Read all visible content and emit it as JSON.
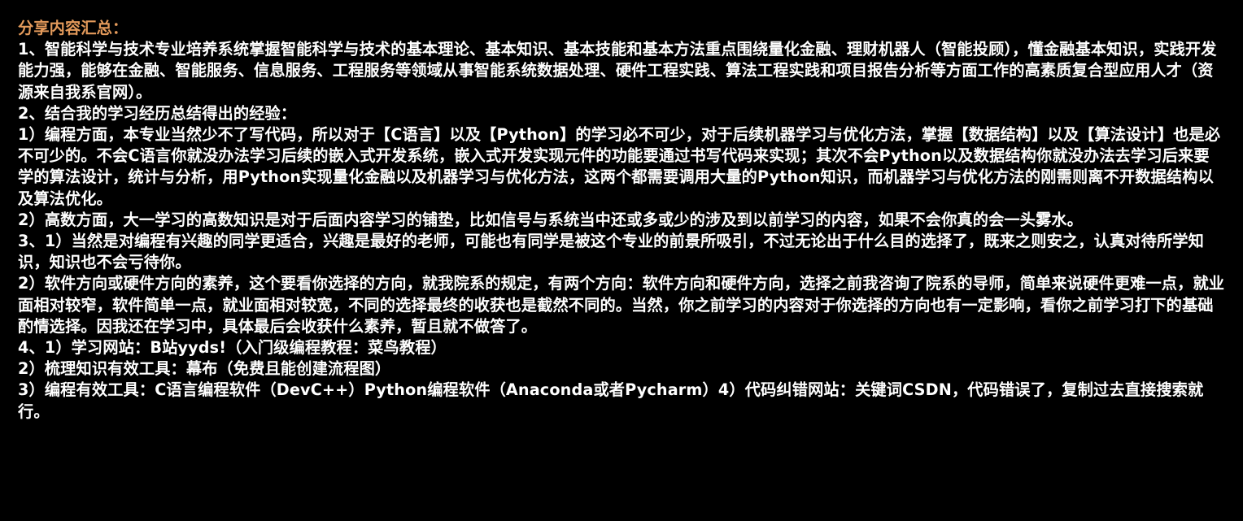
{
  "heading": "分享内容汇总：",
  "paragraphs": [
    "1、智能科学与技术专业培养系统掌握智能科学与技术的基本理论、基本知识、基本技能和基本方法重点围绕量化金融、理财机器人（智能投顾），懂金融基本知识，实践开发能力强，能够在金融、智能服务、信息服务、工程服务等领域从事智能系统数据处理、硬件工程实践、算法工程实践和项目报告分析等方面工作的高素质复合型应用人才（资源来自我系官网）。",
    "2、结合我的学习经历总结得出的经验：",
    "1）编程方面，本专业当然少不了写代码，所以对于【C语言】以及【Python】的学习必不可少，对于后续机器学习与优化方法，掌握【数据结构】以及【算法设计】也是必不可少的。不会C语言你就没办法学习后续的嵌入式开发系统，嵌入式开发实现元件的功能要通过书写代码来实现；其次不会Python以及数据结构你就没办法去学习后来要学的算法设计，统计与分析，用Python实现量化金融以及机器学习与优化方法，这两个都需要调用大量的Python知识，而机器学习与优化方法的刚需则离不开数据结构以及算法优化。",
    "2）高数方面，大一学习的高数知识是对于后面内容学习的铺垫，比如信号与系统当中还或多或少的涉及到以前学习的内容，如果不会你真的会一头雾水。",
    "3、1）当然是对编程有兴趣的同学更适合，兴趣是最好的老师，可能也有同学是被这个专业的前景所吸引，不过无论出于什么目的选择了，既来之则安之，认真对待所学知识，知识也不会亏待你。",
    "2）软件方向或硬件方向的素养，这个要看你选择的方向，就我院系的规定，有两个方向：软件方向和硬件方向，选择之前我咨询了院系的导师，简单来说硬件更难一点，就业面相对较窄，软件简单一点，就业面相对较宽，不同的选择最终的收获也是截然不同的。当然，你之前学习的内容对于你选择的方向也有一定影响，看你之前学习打下的基础酌情选择。因我还在学习中，具体最后会收获什么素养，暂且就不做答了。",
    "4、1）学习网站：B站yyds!（入门级编程教程：菜鸟教程）",
    "2）梳理知识有效工具：幕布（免费且能创建流程图）",
    "3）编程有效工具：C语言编程软件（DevC++）Python编程软件（Anaconda或者Pycharm）4）代码纠错网站：关键词CSDN，代码错误了，复制过去直接搜索就行。"
  ],
  "colors": {
    "background": "#000000",
    "heading": "#e39a5b",
    "text": "#ffffff"
  }
}
